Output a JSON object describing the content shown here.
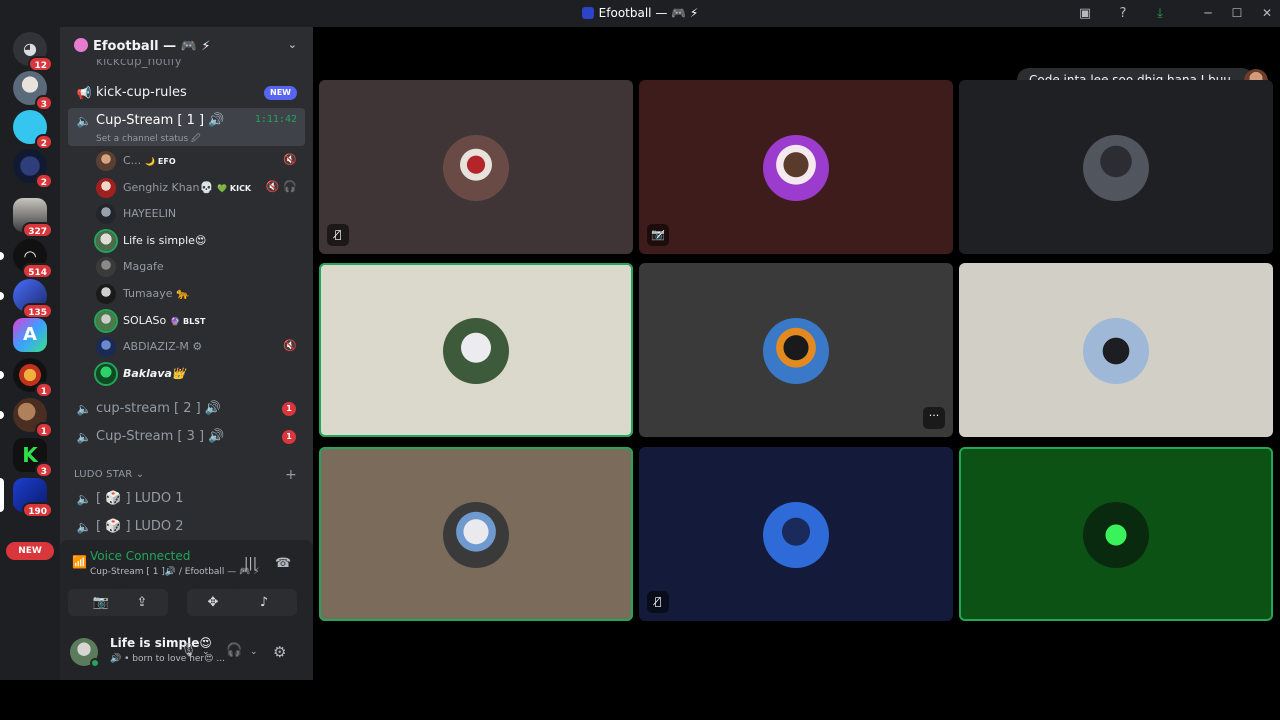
{
  "titlebar": {
    "title": "Efootball — 🎮 ⚡",
    "icons": [
      "screen-share-icon",
      "help-icon",
      "download-icon"
    ],
    "window_buttons": [
      "─",
      "☐",
      "✕"
    ]
  },
  "rail": {
    "badges": [
      "12",
      "3",
      "2",
      "2",
      "327",
      "514",
      "135",
      "",
      "1",
      "1",
      "",
      "3",
      "190"
    ],
    "new_label": "NEW"
  },
  "sidebar": {
    "guild_name": "Efootball — 🎮 ⚡",
    "cut_channel": "kickcup_notify",
    "channels": {
      "kick_cup_rules": {
        "label": "kick-cup-rules",
        "badge": "NEW"
      },
      "cup_stream_1": {
        "label": "Cup-Stream [ 1 ] 🔊",
        "timer": "1:11:42",
        "status": "Set a channel status 🖉"
      },
      "cup_stream_2": {
        "label": "cup-stream [ 2 ] 🔊",
        "count": "1"
      },
      "cup_stream_3": {
        "label": "Cup-Stream [ 3 ] 🔊",
        "count": "1"
      },
      "ludo_1": {
        "label": "[ 🎲 ] LUDO 1"
      },
      "ludo_2": {
        "label": "[ 🎲 ] LUDO 2"
      }
    },
    "voice_users": [
      {
        "name": "C...",
        "tag": "🌙 EFO",
        "mutes": "🔇"
      },
      {
        "name": "Genghiz Khan💀",
        "tag": "💚 KICK",
        "mutes": "🔇🎧"
      },
      {
        "name": "HAYEELIN",
        "tag": "",
        "mutes": ""
      },
      {
        "name": "Life is simple😍",
        "tag": "",
        "mutes": ""
      },
      {
        "name": "Magafe",
        "tag": "",
        "mutes": ""
      },
      {
        "name": "Tumaaye 🐆",
        "tag": "",
        "mutes": ""
      },
      {
        "name": "SOLASo",
        "tag": "🔮 BLST",
        "mutes": ""
      },
      {
        "name": "ABDIAZIZ-M ⚙",
        "tag": "",
        "mutes": "🔇"
      },
      {
        "name": "Baklava👑",
        "tag": "",
        "mutes": ""
      }
    ],
    "category": {
      "label": "LUDO STAR ⌄",
      "add": "+"
    }
  },
  "voice_panel": {
    "title": "Voice Connected",
    "subtitle": "Cup-Stream [ 1 ]🔊 / Efootball — 🎮 ⚡",
    "buttons": [
      "camera-off",
      "screen-share",
      "activities",
      "soundboard"
    ]
  },
  "user_panel": {
    "name": "Life is simple😍",
    "status": "🔊 • born to love her😍 ..."
  },
  "main": {
    "toast": "Code inta lee soo dhig hana I buu...",
    "more_label": "···",
    "mute_glyph": "🎙̸",
    "video_off_glyph": "📷̸"
  },
  "colors": {
    "accent_green": "#23a55a",
    "danger_red": "#da373c",
    "blurple": "#5865f2",
    "tile_colors": [
      "#3f3537",
      "#3e1c1c",
      "#1f2024",
      "#dbd8cc",
      "#3a3a3a",
      "#d2cfc6",
      "#7b6b5a",
      "#141b3a",
      "#0c5214"
    ]
  }
}
